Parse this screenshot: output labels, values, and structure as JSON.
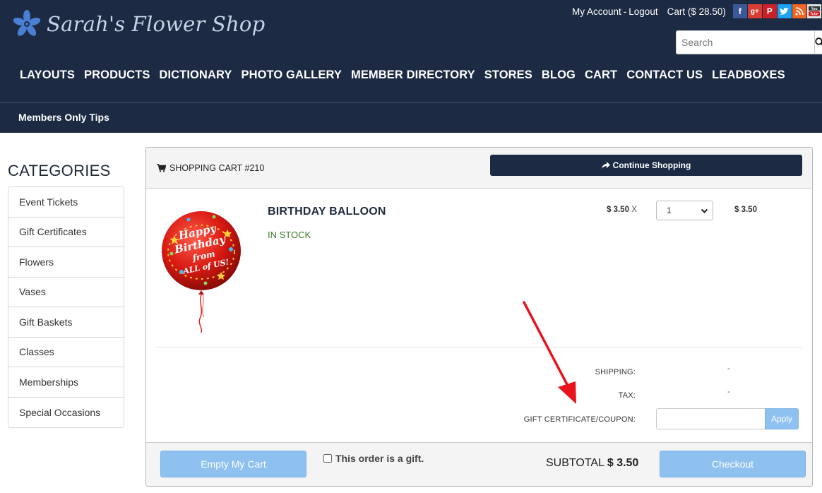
{
  "brand": {
    "name": "Sarah's Flower Shop"
  },
  "top_links": {
    "account": "My Account",
    "separator": "-",
    "logout": "Logout",
    "cart": "Cart ($ 28.50)"
  },
  "social_icons": [
    "facebook-icon",
    "google-plus-icon",
    "pinterest-icon",
    "twitter-icon",
    "rss-icon",
    "youtube-icon"
  ],
  "search": {
    "placeholder": "Search"
  },
  "nav": {
    "items": [
      "LAYOUTS",
      "PRODUCTS",
      "DICTIONARY",
      "PHOTO GALLERY",
      "MEMBER DIRECTORY",
      "STORES",
      "BLOG",
      "CART",
      "CONTACT US",
      "LEADBOXES"
    ]
  },
  "subnav": {
    "item": "Members Only Tips"
  },
  "sidebar": {
    "title": "CATEGORIES",
    "items": [
      "Event Tickets",
      "Gift Certificates",
      "Flowers",
      "Vases",
      "Gift Baskets",
      "Classes",
      "Memberships",
      "Special Occasions"
    ]
  },
  "cart": {
    "title": "SHOPPING CART #210",
    "continue_label": "Continue Shopping",
    "item": {
      "name": "BIRTHDAY BALLOON",
      "stock": "IN STOCK",
      "unit_price": "$ 3.50",
      "times": "X",
      "quantity": "1",
      "line_total": "$ 3.50",
      "image_text": [
        "Happy",
        "Birthday",
        "from",
        "ALL of US!"
      ]
    },
    "shipping_label": "SHIPPING:",
    "shipping_value": "-",
    "tax_label": "TAX:",
    "tax_value": "-",
    "coupon_label": "GIFT CERTIFICATE/COUPON:",
    "apply_label": "Apply",
    "empty_label": "Empty My Cart",
    "gift_label": "This order is a gift.",
    "subtotal_label": "SUBTOTAL",
    "subtotal_value": "$ 3.50",
    "checkout_label": "Checkout"
  },
  "colors": {
    "header_bg": "#1c2a44",
    "button_blue": "#8ec1f0",
    "stock_green": "#3a7b2e",
    "arrow_red": "#e8141c"
  }
}
